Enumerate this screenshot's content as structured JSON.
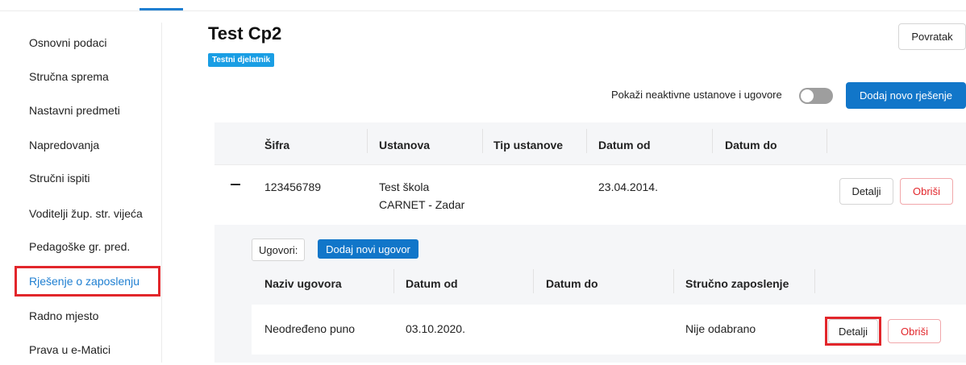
{
  "sidebar": {
    "items": [
      {
        "label": "Osnovni podaci"
      },
      {
        "label": "Stručna sprema"
      },
      {
        "label": "Nastavni predmeti"
      },
      {
        "label": "Napredovanja"
      },
      {
        "label": "Stručni ispiti"
      },
      {
        "label": "Voditelji žup. str. vijeća"
      },
      {
        "label": "Pedagoške gr. pred."
      },
      {
        "label": "Rješenje o zaposlenju",
        "active": true
      },
      {
        "label": "Radno mjesto"
      },
      {
        "label": "Prava u e-Matici"
      }
    ]
  },
  "header": {
    "title": "Test Cp2",
    "badge": "Testni djelatnik",
    "back_label": "Povratak",
    "toggle_label": "Pokaži neaktivne ustanove i ugovore",
    "toggle_on": false,
    "add_decision_label": "Dodaj novo rješenje"
  },
  "decisions": {
    "columns": [
      "Šifra",
      "Ustanova",
      "Tip ustanove",
      "Datum od",
      "Datum do"
    ],
    "rows": [
      {
        "sifra": "123456789",
        "ustanova_line1": "Test škola",
        "ustanova_line2": "CARNET - Zadar",
        "tip_ustanove": "",
        "datum_od": "23.04.2014.",
        "datum_do": "",
        "details_label": "Detalji",
        "delete_label": "Obriši"
      }
    ]
  },
  "contracts": {
    "label": "Ugovori:",
    "add_label": "Dodaj novi ugovor",
    "columns": [
      "Naziv ugovora",
      "Datum od",
      "Datum do",
      "Stručno zaposlenje"
    ],
    "rows": [
      {
        "naziv": "Neodređeno puno",
        "datum_od": "03.10.2020.",
        "datum_do": "",
        "strucno_zaposlenje": "Nije odabrano",
        "details_label": "Detalji",
        "delete_label": "Obriši"
      }
    ]
  },
  "colors": {
    "accent": "#1176c9",
    "badge": "#1a9ee4",
    "danger": "#e2262b"
  }
}
